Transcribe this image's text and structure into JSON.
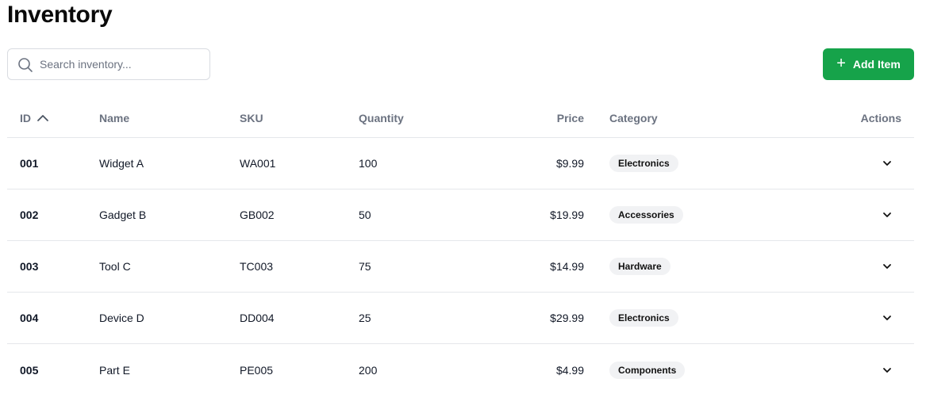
{
  "page": {
    "title": "Inventory"
  },
  "search": {
    "placeholder": "Search inventory..."
  },
  "toolbar": {
    "add_label": "Add Item"
  },
  "table": {
    "columns": {
      "id": "ID",
      "name": "Name",
      "sku": "SKU",
      "quantity": "Quantity",
      "price": "Price",
      "category": "Category",
      "actions": "Actions"
    },
    "sort": {
      "column": "ID",
      "direction": "ascending"
    },
    "rows": [
      {
        "id": "001",
        "name": "Widget A",
        "sku": "WA001",
        "quantity": "100",
        "price": "$9.99",
        "category": "Electronics"
      },
      {
        "id": "002",
        "name": "Gadget B",
        "sku": "GB002",
        "quantity": "50",
        "price": "$19.99",
        "category": "Accessories"
      },
      {
        "id": "003",
        "name": "Tool C",
        "sku": "TC003",
        "quantity": "75",
        "price": "$14.99",
        "category": "Hardware"
      },
      {
        "id": "004",
        "name": "Device D",
        "sku": "DD004",
        "quantity": "25",
        "price": "$29.99",
        "category": "Electronics"
      },
      {
        "id": "005",
        "name": "Part E",
        "sku": "PE005",
        "quantity": "200",
        "price": "$4.99",
        "category": "Components"
      }
    ]
  },
  "icons": {
    "search": "search-icon",
    "add": "plus-icon",
    "sort": "chevron-up-icon",
    "row_action": "chevron-down-icon"
  },
  "colors": {
    "accent": "#16a34a",
    "badge_bg": "#f1f2f4",
    "header_text": "#6b7280"
  }
}
